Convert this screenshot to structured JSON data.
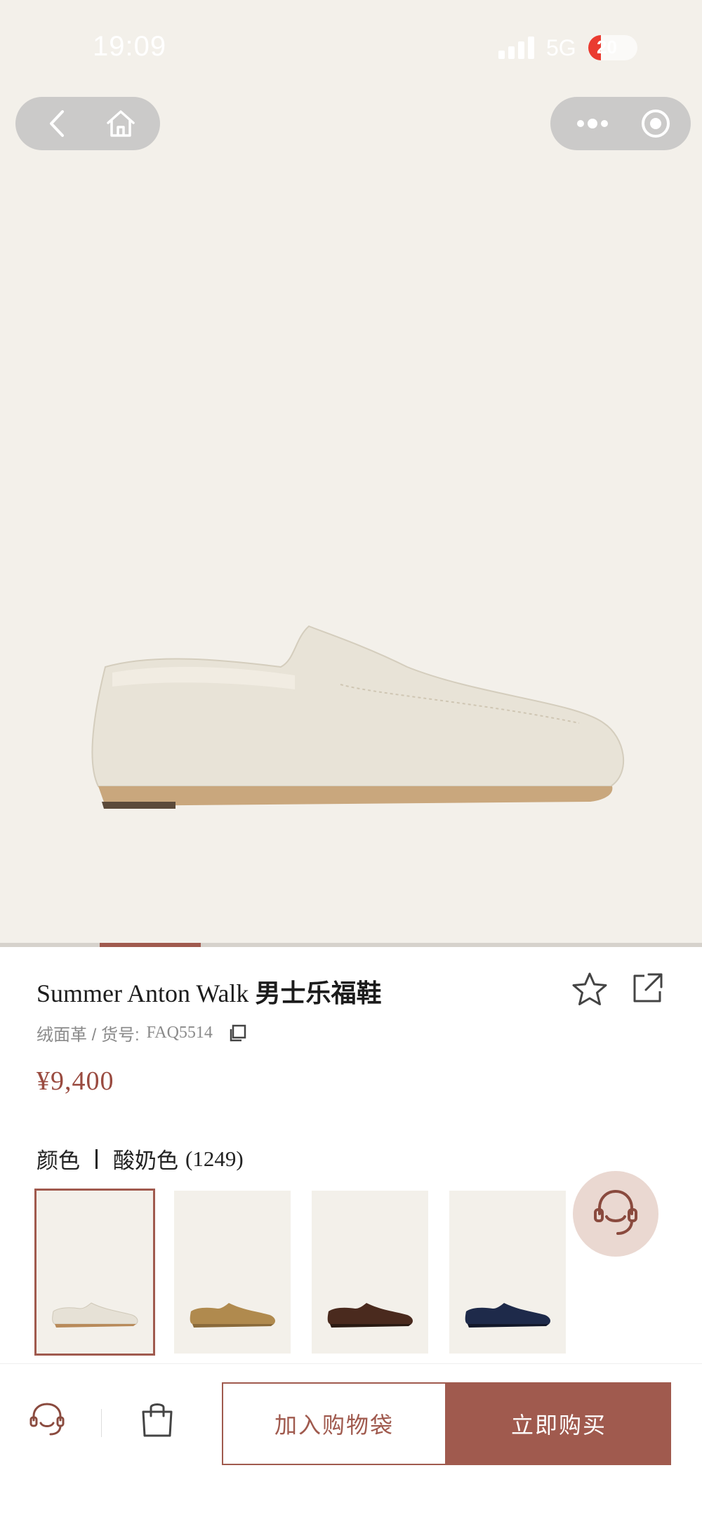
{
  "status_bar": {
    "time": "19:09",
    "network": "5G",
    "battery": "20"
  },
  "product": {
    "name_en": "Summer Anton Walk",
    "name_cn": "男士乐福鞋",
    "material_sku_label": "绒面革 / 货号:",
    "sku": "FAQ5514",
    "price": "¥9,400"
  },
  "color_section": {
    "label": "颜色",
    "selected_color": "酸奶色",
    "selected_count": "(1249)"
  },
  "swatches": [
    {
      "color": "#e6e1d6",
      "sole": "#b88a5a"
    },
    {
      "color": "#b08a4e",
      "sole": "#8a6a3a"
    },
    {
      "color": "#4a2a1e",
      "sole": "#2a1a12"
    },
    {
      "color": "#1e2a4a",
      "sole": "#12182a"
    }
  ],
  "bottom_bar": {
    "add_to_bag": "加入购物袋",
    "buy_now": "立即购买"
  },
  "colors": {
    "accent": "#a05a4e",
    "price": "#9a4b40",
    "hero_bg": "#f3f0ea"
  },
  "icons": [
    "back-icon",
    "home-icon",
    "more-icon",
    "target-icon",
    "favorite-icon",
    "share-icon",
    "copy-icon",
    "customer-service-icon",
    "shopping-bag-icon"
  ]
}
